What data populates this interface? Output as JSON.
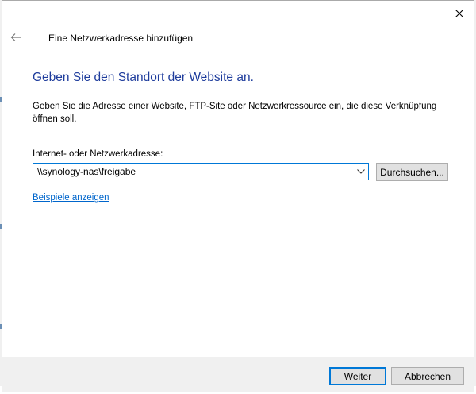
{
  "dialog": {
    "title": "Eine Netzwerkadresse hinzufügen",
    "heading": "Geben Sie den Standort der Website an.",
    "description": "Geben Sie die Adresse einer Website, FTP-Site oder Netzwerkressource ein, die diese Verknüpfung öffnen soll.",
    "address_label": "Internet- oder Netzwerkadresse:",
    "address_value": "\\\\synology-nas\\freigabe",
    "browse_label": "Durchsuchen...",
    "examples_link": "Beispiele anzeigen",
    "next_label": "Weiter",
    "cancel_label": "Abbrechen"
  },
  "icons": {
    "close": "close-icon",
    "back": "back-arrow-icon",
    "dropdown": "chevron-down-icon"
  },
  "colors": {
    "heading": "#1e3c9c",
    "link": "#0066cc",
    "focus_border": "#0078d7",
    "footer_bg": "#f0f0f0"
  }
}
